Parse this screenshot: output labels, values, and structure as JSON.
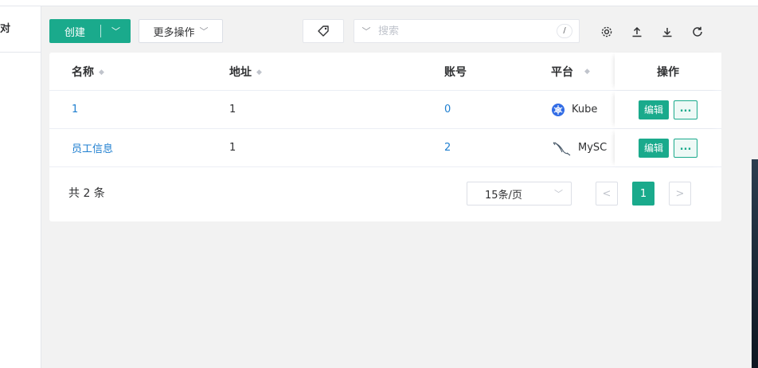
{
  "left_panel": {
    "item_label": "对"
  },
  "toolbar": {
    "create_label": "创建",
    "more_label": "更多操作",
    "search_placeholder": "搜索",
    "search_shortcut": "/"
  },
  "table": {
    "headers": {
      "name": "名称",
      "address": "地址",
      "account": "账号",
      "platform": "平台",
      "actions": "操作"
    },
    "rows": [
      {
        "name": "1",
        "address": "1",
        "account": "0",
        "platform": "Kube",
        "platform_icon": "kubernetes-icon",
        "edit_label": "编辑",
        "more_label": "..."
      },
      {
        "name": "员工信息",
        "address": "1",
        "account": "2",
        "platform": "MySC",
        "platform_icon": "mysql-icon",
        "edit_label": "编辑",
        "more_label": "..."
      }
    ]
  },
  "footer": {
    "total": "共 2 条",
    "page_size": "15条/页",
    "prev": "<",
    "current_page": "1",
    "next": ">"
  },
  "colors": {
    "accent": "#1aaa8c",
    "link": "#1f7fd0"
  }
}
